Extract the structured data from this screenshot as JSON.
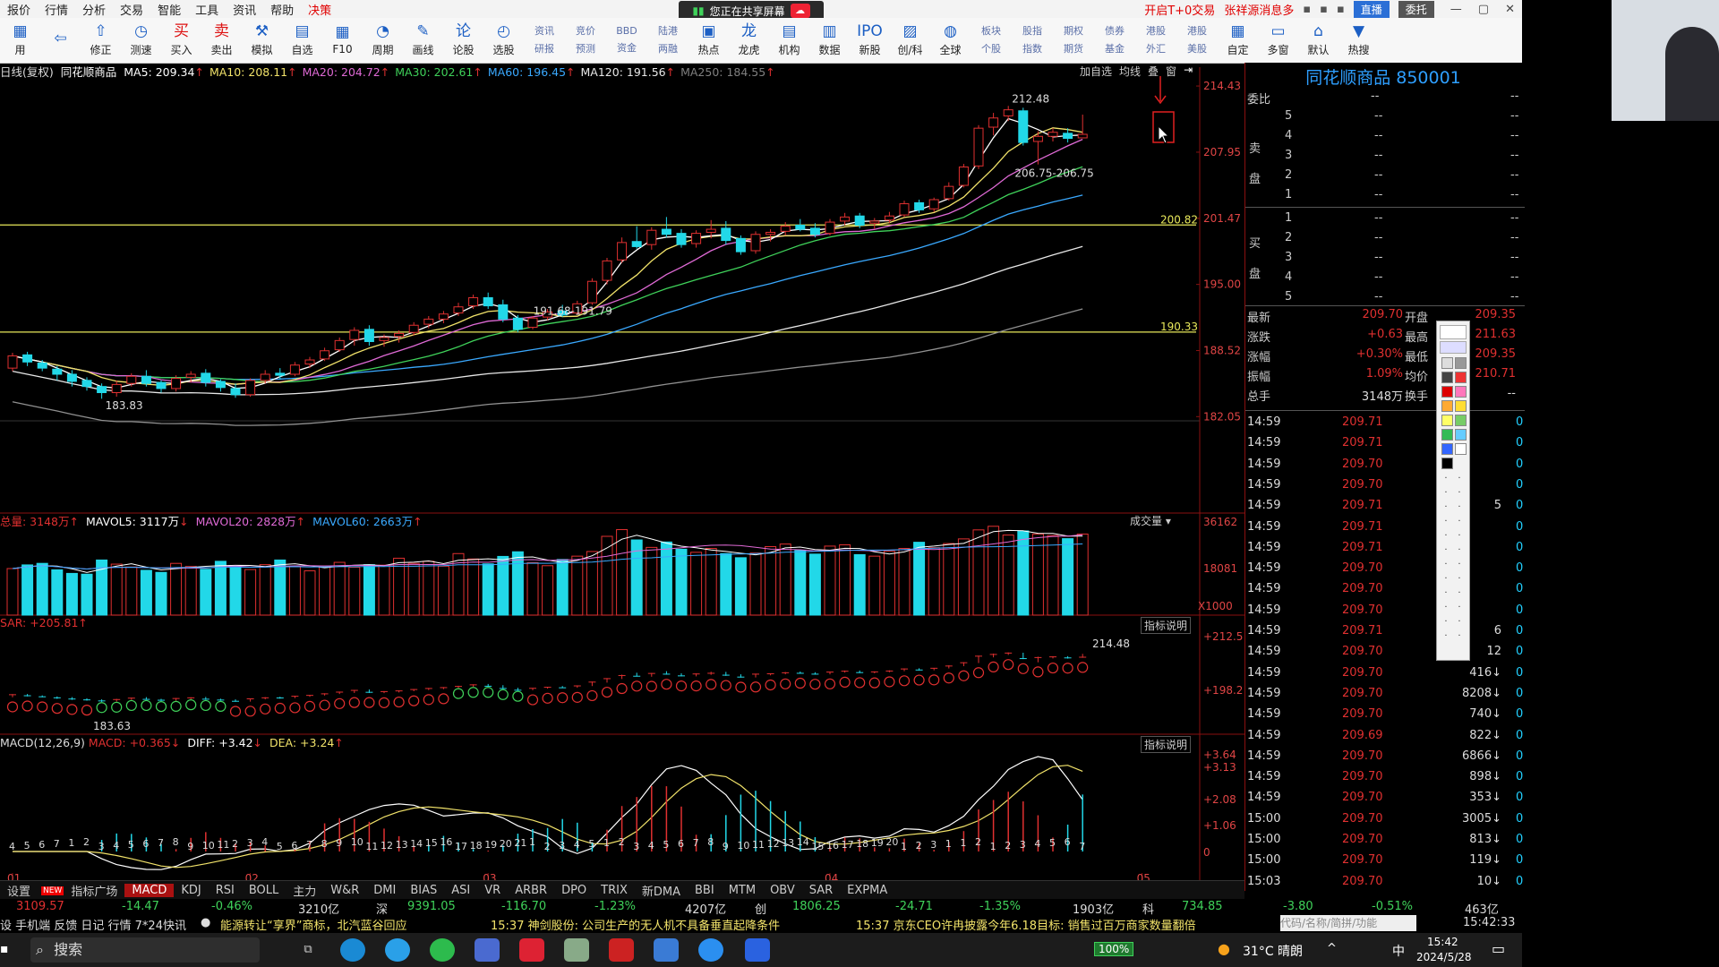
{
  "menu": [
    "报价",
    "行情",
    "分析",
    "交易",
    "智能",
    "工具",
    "资讯",
    "帮助",
    "决策"
  ],
  "menu_right": {
    "promo1": "开启T+0交易",
    "promo2": "张祥源消息多",
    "live": "直播",
    "trade": "委托"
  },
  "share_banner": "您正在共享屏幕",
  "toolbar": [
    {
      "label": "用",
      "icon": "apps-icon"
    },
    {
      "label": "",
      "icon": "back-arrow-icon"
    },
    {
      "label": "修正",
      "icon": "pin-icon"
    },
    {
      "label": "测速",
      "icon": "speed-icon"
    },
    {
      "label": "买入",
      "icon": "buy-icon",
      "glyph": "买"
    },
    {
      "label": "卖出",
      "icon": "sell-icon",
      "glyph": "卖"
    },
    {
      "label": "模拟",
      "icon": "simulate-icon"
    },
    {
      "label": "自选",
      "icon": "watchlist-icon"
    },
    {
      "label": "F10",
      "icon": "f10-icon"
    },
    {
      "label": "周期",
      "icon": "period-icon"
    },
    {
      "label": "画线",
      "icon": "draw-icon"
    },
    {
      "label": "论股",
      "icon": "discuss-icon",
      "glyph": "论"
    },
    {
      "label": "选股",
      "icon": "pick-icon"
    }
  ],
  "toolbar2": [
    {
      "top": "资讯",
      "bottom": "研报"
    },
    {
      "top": "竞价",
      "bottom": "预测"
    },
    {
      "top": "BBD",
      "bottom": "资金"
    },
    {
      "top": "陆港",
      "bottom": "两融"
    }
  ],
  "toolbar3": [
    {
      "label": "热点",
      "icon": "hot-icon"
    },
    {
      "label": "龙虎",
      "icon": "dragon-icon",
      "glyph": "龙"
    },
    {
      "label": "机构",
      "icon": "institution-icon"
    },
    {
      "label": "数据",
      "icon": "data-icon"
    },
    {
      "label": "新股",
      "icon": "ipo-icon",
      "glyph": "IPO"
    },
    {
      "label": "创/科",
      "icon": "startup-icon"
    },
    {
      "label": "全球",
      "icon": "globe-icon"
    }
  ],
  "toolbar4": [
    {
      "top": "板块",
      "bottom": "个股"
    },
    {
      "top": "股指",
      "bottom": "指数"
    },
    {
      "top": "期权",
      "bottom": "期货"
    },
    {
      "top": "债券",
      "bottom": "基金"
    },
    {
      "top": "港股",
      "bottom": "外汇"
    },
    {
      "top": "港股",
      "bottom": "美股"
    }
  ],
  "toolbar5": [
    {
      "label": "自定",
      "icon": "custom-icon"
    },
    {
      "label": "多窗",
      "icon": "multiwindow-icon"
    },
    {
      "label": "默认",
      "icon": "home-icon"
    },
    {
      "label": "热搜",
      "icon": "hotsearch-icon"
    }
  ],
  "ma_header": {
    "period": "日线(复权)",
    "name": "同花顺商品",
    "ma5": "MA5: 209.34",
    "ma10": "MA10: 208.11",
    "ma20": "MA20: 204.72",
    "ma30": "MA30: 202.61",
    "ma60": "MA60: 196.45",
    "ma120": "MA120: 191.56",
    "ma250": "MA250: 184.55"
  },
  "chart_tools": [
    "加自选",
    "均线",
    "叠",
    "窗"
  ],
  "vol_header": {
    "vol": "总量: 3148万",
    "mavol5": "MAVOL5: 3117万",
    "mavol20": "MAVOL20: 2828万",
    "mavol60": "MAVOL60: 2663万"
  },
  "sar_header": "SAR: +205.81",
  "macd_header": {
    "name": "MACD(12,26,9)",
    "macd": "MACD: +0.365",
    "diff": "DIFF: +3.42",
    "dea": "DEA: +3.24"
  },
  "indicator_btn": "指标说明",
  "vol_btn": "成交量",
  "vol_unit": "X1000",
  "colors": {
    "up": "#e03030",
    "down": "#22d8e8",
    "ma5": "#ffffff",
    "ma10": "#f2e36a",
    "ma20": "#e06ad6",
    "ma30": "#3fd25a",
    "ma60": "#3aa9ff",
    "ma120": "#e8e8e8",
    "ma250": "#909090",
    "hline": "#e8e85a"
  },
  "chart_data": {
    "type": "candlestick",
    "price_axis": [
      "214.43",
      "207.95",
      "201.47",
      "195.00",
      "188.52",
      "182.05"
    ],
    "ylim": [
      181.2,
      215.4
    ],
    "hlines": [
      {
        "value": 200.82,
        "label": "200.82"
      },
      {
        "value": 190.33,
        "label": "190.33"
      }
    ],
    "annotations": [
      {
        "text": "212.48",
        "value": 212.48
      },
      {
        "text": "206.75-206.75",
        "value": 206.75
      },
      {
        "text": "191.68-191.79",
        "value": 191.7
      },
      {
        "text": "183.83",
        "value": 183.83
      }
    ],
    "candles": [
      [
        186.8,
        188.3,
        186.5,
        188.0
      ],
      [
        188.1,
        188.4,
        187.0,
        187.4
      ],
      [
        187.3,
        187.6,
        186.5,
        186.8
      ],
      [
        186.7,
        187.0,
        185.6,
        186.2
      ],
      [
        186.2,
        186.6,
        185.0,
        185.5
      ],
      [
        185.6,
        185.9,
        184.6,
        185.0
      ],
      [
        185.0,
        185.3,
        183.8,
        184.4
      ],
      [
        184.4,
        185.6,
        184.0,
        185.2
      ],
      [
        185.3,
        186.3,
        185.0,
        186.0
      ],
      [
        186.0,
        186.6,
        185.0,
        185.3
      ],
      [
        185.4,
        185.6,
        184.4,
        184.8
      ],
      [
        184.8,
        186.1,
        184.5,
        185.8
      ],
      [
        185.9,
        186.5,
        185.4,
        186.2
      ],
      [
        186.3,
        186.7,
        185.0,
        185.4
      ],
      [
        185.5,
        185.7,
        184.5,
        184.9
      ],
      [
        184.8,
        185.3,
        183.9,
        184.2
      ],
      [
        184.2,
        185.8,
        184.0,
        185.6
      ],
      [
        185.6,
        186.6,
        185.3,
        186.2
      ],
      [
        186.3,
        186.8,
        185.7,
        186.1
      ],
      [
        186.2,
        187.4,
        186.0,
        187.1
      ],
      [
        187.2,
        187.9,
        186.8,
        187.6
      ],
      [
        187.7,
        188.8,
        187.5,
        188.5
      ],
      [
        188.6,
        189.8,
        188.4,
        189.5
      ],
      [
        189.6,
        190.8,
        189.0,
        190.5
      ],
      [
        190.6,
        191.0,
        189.0,
        189.4
      ],
      [
        189.5,
        190.1,
        188.9,
        189.8
      ],
      [
        189.9,
        190.5,
        189.3,
        190.2
      ],
      [
        190.3,
        191.3,
        190.0,
        191.0
      ],
      [
        191.1,
        191.9,
        190.7,
        191.6
      ],
      [
        191.6,
        192.4,
        191.2,
        192.1
      ],
      [
        192.2,
        193.2,
        191.9,
        192.8
      ],
      [
        192.9,
        194.0,
        192.6,
        193.7
      ],
      [
        193.7,
        194.2,
        192.6,
        192.9
      ],
      [
        193.0,
        193.5,
        191.3,
        191.6
      ],
      [
        191.7,
        192.0,
        190.3,
        190.6
      ],
      [
        190.8,
        191.9,
        190.6,
        191.7
      ],
      [
        191.8,
        192.6,
        191.5,
        192.3
      ],
      [
        192.4,
        193.0,
        191.8,
        192.0
      ],
      [
        192.2,
        193.4,
        192.0,
        193.1
      ],
      [
        193.2,
        195.6,
        193.0,
        195.3
      ],
      [
        195.4,
        197.6,
        195.0,
        197.3
      ],
      [
        197.4,
        199.6,
        197.1,
        199.1
      ],
      [
        199.2,
        200.7,
        198.5,
        198.7
      ],
      [
        198.9,
        200.6,
        198.4,
        200.3
      ],
      [
        200.4,
        201.6,
        199.6,
        199.9
      ],
      [
        200.0,
        200.4,
        198.6,
        198.9
      ],
      [
        199.0,
        200.3,
        198.6,
        200.0
      ],
      [
        200.1,
        201.3,
        199.5,
        200.4
      ],
      [
        200.5,
        201.2,
        198.9,
        199.3
      ],
      [
        199.5,
        199.8,
        197.9,
        198.2
      ],
      [
        198.3,
        200.2,
        198.0,
        199.9
      ],
      [
        199.9,
        200.4,
        199.2,
        200.1
      ],
      [
        200.2,
        201.1,
        199.8,
        200.7
      ],
      [
        200.8,
        201.4,
        200.2,
        200.4
      ],
      [
        200.5,
        201.0,
        199.6,
        199.9
      ],
      [
        200.0,
        201.4,
        199.8,
        201.1
      ],
      [
        201.2,
        202.0,
        200.8,
        201.6
      ],
      [
        201.7,
        202.0,
        200.5,
        200.8
      ],
      [
        201.0,
        201.5,
        200.4,
        201.2
      ],
      [
        201.3,
        202.1,
        201.0,
        201.7
      ],
      [
        201.8,
        203.2,
        201.6,
        202.9
      ],
      [
        203.0,
        203.3,
        202.0,
        202.3
      ],
      [
        202.4,
        203.5,
        202.1,
        203.3
      ],
      [
        203.4,
        205.0,
        203.2,
        204.6
      ],
      [
        204.7,
        206.8,
        204.5,
        206.5
      ],
      [
        206.6,
        210.6,
        206.3,
        210.3
      ],
      [
        210.4,
        211.8,
        209.6,
        211.3
      ],
      [
        211.5,
        212.48,
        211.0,
        212.1
      ],
      [
        212.0,
        212.3,
        208.6,
        208.9
      ],
      [
        209.0,
        210.0,
        206.75,
        209.5
      ],
      [
        209.5,
        210.3,
        209.0,
        209.9
      ],
      [
        209.8,
        210.3,
        208.9,
        209.3
      ],
      [
        209.35,
        211.63,
        209.35,
        209.7
      ]
    ],
    "volume_max": 36162,
    "volume_axis": [
      "36162",
      "18081"
    ],
    "volume": [
      18081,
      19500,
      20100,
      17600,
      16200,
      15900,
      21400,
      19800,
      18700,
      17400,
      16600,
      20100,
      18900,
      17800,
      20900,
      19300,
      17700,
      19600,
      21400,
      18900,
      17200,
      19100,
      20500,
      18600,
      19600,
      19400,
      22100,
      20100,
      20900,
      19000,
      23900,
      21800,
      19900,
      22800,
      24600,
      20400,
      19200,
      21600,
      22900,
      24700,
      30600,
      33200,
      29200,
      26300,
      28400,
      25600,
      24400,
      25900,
      23900,
      22300,
      24100,
      26600,
      27600,
      25100,
      23700,
      26800,
      27300,
      23500,
      22900,
      24800,
      25900,
      28300,
      26200,
      27800,
      29600,
      33100,
      34500,
      31100,
      32700,
      31500,
      30900,
      29700,
      31480
    ],
    "sar_axis": [
      "+212.5",
      "+198.2"
    ],
    "sar_annotations": [
      {
        "text": "214.48"
      },
      {
        "text": "183.63"
      }
    ],
    "macd_axis": [
      "+3.64",
      "+3.13",
      "+2.08",
      "+1.06",
      "0"
    ],
    "macd_counts": [
      "4",
      "5",
      "6",
      "7",
      "1",
      "2",
      "3",
      "4",
      "5",
      "6",
      "7",
      "8",
      "9",
      "10",
      "11",
      "2",
      "3",
      "4",
      "5",
      "6",
      "7",
      "8",
      "9",
      "10",
      "11",
      "12",
      "13",
      "14",
      "15",
      "16",
      "17",
      "18",
      "19",
      "20",
      "21",
      "1",
      "2",
      "3",
      "4",
      "5",
      "1",
      "2",
      "3",
      "4",
      "5",
      "6",
      "7",
      "8",
      "9",
      "10",
      "11",
      "12",
      "13",
      "14",
      "15",
      "16",
      "17",
      "18",
      "19",
      "20",
      "1",
      "2",
      "3",
      "1",
      "1",
      "2",
      "1",
      "2",
      "3",
      "4",
      "5",
      "6",
      "7",
      "8",
      "9"
    ],
    "x_labels": [
      {
        "label": "01",
        "i": 0
      },
      {
        "label": "02",
        "i": 16
      },
      {
        "label": "03",
        "i": 32
      },
      {
        "label": "04",
        "i": 55
      },
      {
        "label": "05",
        "i": 76
      }
    ]
  },
  "right_panel": {
    "title": "同花顺商品 850001",
    "order_ratio": "委比",
    "sell_label": "卖盘",
    "buy_label": "买盘",
    "order_levels": [
      "5",
      "4",
      "3",
      "2",
      "1",
      "1",
      "2",
      "3",
      "4",
      "5"
    ],
    "order_empty": "--",
    "quote": [
      {
        "l": "最新",
        "v": "209.70",
        "l2": "开盘",
        "v2": "209.35"
      },
      {
        "l": "涨跌",
        "v": "+0.63",
        "l2": "最高",
        "v2": "211.63"
      },
      {
        "l": "涨幅",
        "v": "+0.30%",
        "l2": "最低",
        "v2": "209.35"
      },
      {
        "l": "振幅",
        "v": "1.09%",
        "l2": "均价",
        "v2": "210.71"
      },
      {
        "l": "总手",
        "v": "3148万",
        "l2": "换手",
        "v2": "--"
      }
    ],
    "ticks": [
      {
        "t": "14:59",
        "p": "209.71",
        "v": "",
        "a": "0"
      },
      {
        "t": "14:59",
        "p": "209.71",
        "v": "",
        "a": "0"
      },
      {
        "t": "14:59",
        "p": "209.70",
        "v": "",
        "a": "0"
      },
      {
        "t": "14:59",
        "p": "209.70",
        "v": "",
        "a": "0"
      },
      {
        "t": "14:59",
        "p": "209.71",
        "v": "5",
        "a": "0"
      },
      {
        "t": "14:59",
        "p": "209.71",
        "v": "",
        "a": "0"
      },
      {
        "t": "14:59",
        "p": "209.71",
        "v": "",
        "a": "0"
      },
      {
        "t": "14:59",
        "p": "209.70",
        "v": "",
        "a": "0"
      },
      {
        "t": "14:59",
        "p": "209.70",
        "v": "",
        "a": "0"
      },
      {
        "t": "14:59",
        "p": "209.70",
        "v": "",
        "a": "0"
      },
      {
        "t": "14:59",
        "p": "209.71",
        "v": "6",
        "a": "0"
      },
      {
        "t": "14:59",
        "p": "209.70",
        "v": "12",
        "a": "0"
      },
      {
        "t": "14:59",
        "p": "209.70",
        "v": "416↓",
        "a": "0"
      },
      {
        "t": "14:59",
        "p": "209.70",
        "v": "8208↓",
        "a": "0"
      },
      {
        "t": "14:59",
        "p": "209.70",
        "v": "740↓",
        "a": "0"
      },
      {
        "t": "14:59",
        "p": "209.69",
        "v": "822↓",
        "a": "0"
      },
      {
        "t": "14:59",
        "p": "209.70",
        "v": "6866↓",
        "a": "0"
      },
      {
        "t": "14:59",
        "p": "209.70",
        "v": "898↓",
        "a": "0"
      },
      {
        "t": "14:59",
        "p": "209.70",
        "v": "353↓",
        "a": "0"
      },
      {
        "t": "15:00",
        "p": "209.70",
        "v": "3005↓",
        "a": "0"
      },
      {
        "t": "15:00",
        "p": "209.70",
        "v": "813↓",
        "a": "0"
      },
      {
        "t": "15:00",
        "p": "209.70",
        "v": "119↓",
        "a": "0"
      },
      {
        "t": "15:03",
        "p": "209.70",
        "v": "10↓",
        "a": "0"
      }
    ]
  },
  "bottom_tabs": [
    "设置",
    "指标广场",
    "MACD",
    "KDJ",
    "RSI",
    "BOLL",
    "主力",
    "W&R",
    "DMI",
    "BIAS",
    "ASI",
    "VR",
    "ARBR",
    "DPO",
    "TRIX",
    "新DMA",
    "BBI",
    "MTM",
    "OBV",
    "SAR",
    "EXPMA"
  ],
  "new_badge": "NEW",
  "index_bar": [
    {
      "text": "3109.57",
      "c": "#e03030",
      "x": 18
    },
    {
      "text": "-14.47",
      "c": "#3fd25a",
      "x": 136
    },
    {
      "text": "-0.46%",
      "c": "#3fd25a",
      "x": 236
    },
    {
      "text": "3210亿",
      "c": "#ddd",
      "x": 333
    },
    {
      "text": "深",
      "c": "#ddd",
      "x": 420
    },
    {
      "text": "9391.05",
      "c": "#3fd25a",
      "x": 455
    },
    {
      "text": "-116.70",
      "c": "#3fd25a",
      "x": 560
    },
    {
      "text": "-1.23%",
      "c": "#3fd25a",
      "x": 664
    },
    {
      "text": "4207亿",
      "c": "#ddd",
      "x": 765
    },
    {
      "text": "创",
      "c": "#ddd",
      "x": 843
    },
    {
      "text": "1806.25",
      "c": "#3fd25a",
      "x": 885
    },
    {
      "text": "-24.71",
      "c": "#3fd25a",
      "x": 1000
    },
    {
      "text": "-1.35%",
      "c": "#3fd25a",
      "x": 1094
    },
    {
      "text": "1903亿",
      "c": "#ddd",
      "x": 1198
    },
    {
      "text": "科",
      "c": "#ddd",
      "x": 1276
    },
    {
      "text": "734.85",
      "c": "#3fd25a",
      "x": 1320
    },
    {
      "text": "-3.80",
      "c": "#3fd25a",
      "x": 1433
    },
    {
      "text": "-0.51%",
      "c": "#3fd25a",
      "x": 1532
    },
    {
      "text": "463亿",
      "c": "#ddd",
      "x": 1636
    }
  ],
  "news_bar": {
    "left": "设 手机端 反馈 日记 行情 7*24快讯",
    "item1": "能源转让“享界”商标，北汽蓝谷回应",
    "item2": "15:37 神剑股份: 公司生产的无人机不具备垂直起降条件",
    "item3": "15:37 京东CEO许冉披露今年6.18目标: 销售过百万商家数量翻倍",
    "clock": "15:42:33",
    "search_placeholder": "代码/名称/简拼/功能"
  },
  "taskbar": {
    "search": "搜索",
    "battery": "100%",
    "weather": "31°C 晴朗",
    "ime": "中",
    "time": "15:42",
    "date": "2024/5/28"
  }
}
